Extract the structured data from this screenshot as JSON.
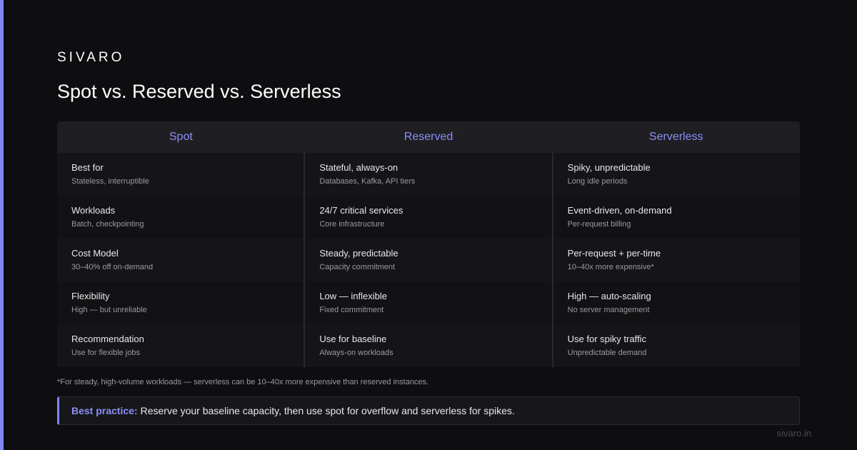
{
  "brand": "SIVARO",
  "title": "Spot vs. Reserved vs. Serverless",
  "columns": [
    {
      "header": "Spot",
      "rows": [
        {
          "main": "Best for",
          "sub": "Stateless, interruptible"
        },
        {
          "main": "Workloads",
          "sub": "Batch, checkpointing"
        },
        {
          "main": "Cost Model",
          "sub": "30–40% off on-demand"
        },
        {
          "main": "Flexibility",
          "sub": "High — but unreliable"
        },
        {
          "main": "Recommendation",
          "sub": "Use for flexible jobs"
        }
      ]
    },
    {
      "header": "Reserved",
      "rows": [
        {
          "main": "Stateful, always-on",
          "sub": "Databases, Kafka, API tiers"
        },
        {
          "main": "24/7 critical services",
          "sub": "Core infrastructure"
        },
        {
          "main": "Steady, predictable",
          "sub": "Capacity commitment"
        },
        {
          "main": "Low — inflexible",
          "sub": "Fixed commitment"
        },
        {
          "main": "Use for baseline",
          "sub": "Always-on workloads"
        }
      ]
    },
    {
      "header": "Serverless",
      "rows": [
        {
          "main": "Spiky, unpredictable",
          "sub": "Long idle periods"
        },
        {
          "main": "Event-driven, on-demand",
          "sub": "Per-request billing"
        },
        {
          "main": "Per-request + per-time",
          "sub": "10–40x more expensive*"
        },
        {
          "main": "High — auto-scaling",
          "sub": "No server management"
        },
        {
          "main": "Use for spiky traffic",
          "sub": "Unpredictable demand"
        }
      ]
    }
  ],
  "footnote": "*For steady, high-volume workloads — serverless can be 10–40x more expensive than reserved instances.",
  "callout": {
    "label": "Best practice:",
    "text": "Reserve your baseline capacity, then use spot for overflow and serverless for spikes."
  },
  "domain": "sivaro.in",
  "colors": {
    "accent": "#7f86f5",
    "background": "#0e0e10",
    "header_bg": "#1f1f23"
  }
}
